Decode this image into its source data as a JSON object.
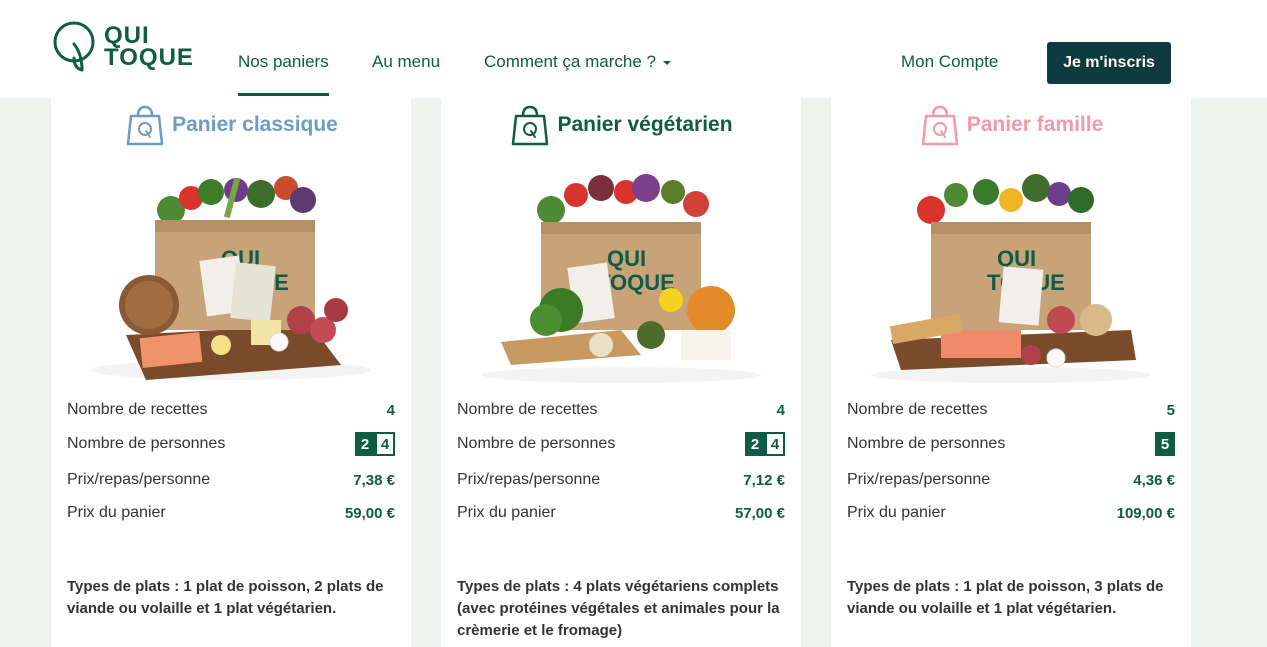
{
  "brand": {
    "line1": "QUI",
    "line2": "TOQUE"
  },
  "nav": {
    "links": [
      "Nos paniers",
      "Au menu",
      "Comment ça marche ?"
    ],
    "account": "Mon Compte",
    "signup": "Je m'inscris"
  },
  "colors": {
    "brand": "#0f5c45",
    "classique": "#6f9cc4",
    "vegetarien": "#0f5c45",
    "famille": "#f29aa8",
    "signup_bg": "#0f3a40"
  },
  "row_labels": [
    "Nombre de recettes",
    "Nombre de personnes",
    "Prix/repas/personne",
    "Prix du panier"
  ],
  "cards": [
    {
      "title": "Panier classique",
      "recettes": "4",
      "personnes": [
        "2",
        "4"
      ],
      "prix_repas": "7,38 €",
      "prix_panier": "59,00 €",
      "types": "Types de plats : 1 plat de poisson, 2 plats de viande ou volaille et 1 plat végétarien."
    },
    {
      "title": "Panier végétarien",
      "recettes": "4",
      "personnes": [
        "2",
        "4"
      ],
      "prix_repas": "7,12 €",
      "prix_panier": "57,00 €",
      "types": "Types de plats : 4 plats végétariens complets (avec protéines végétales et animales pour la crèmerie et le fromage)"
    },
    {
      "title": "Panier famille",
      "recettes": "5",
      "personnes": [
        "5"
      ],
      "prix_repas": "4,36 €",
      "prix_panier": "109,00 €",
      "types": "Types de plats : 1 plat de poisson, 3 plats de viande ou volaille et 1 plat végétarien."
    }
  ]
}
